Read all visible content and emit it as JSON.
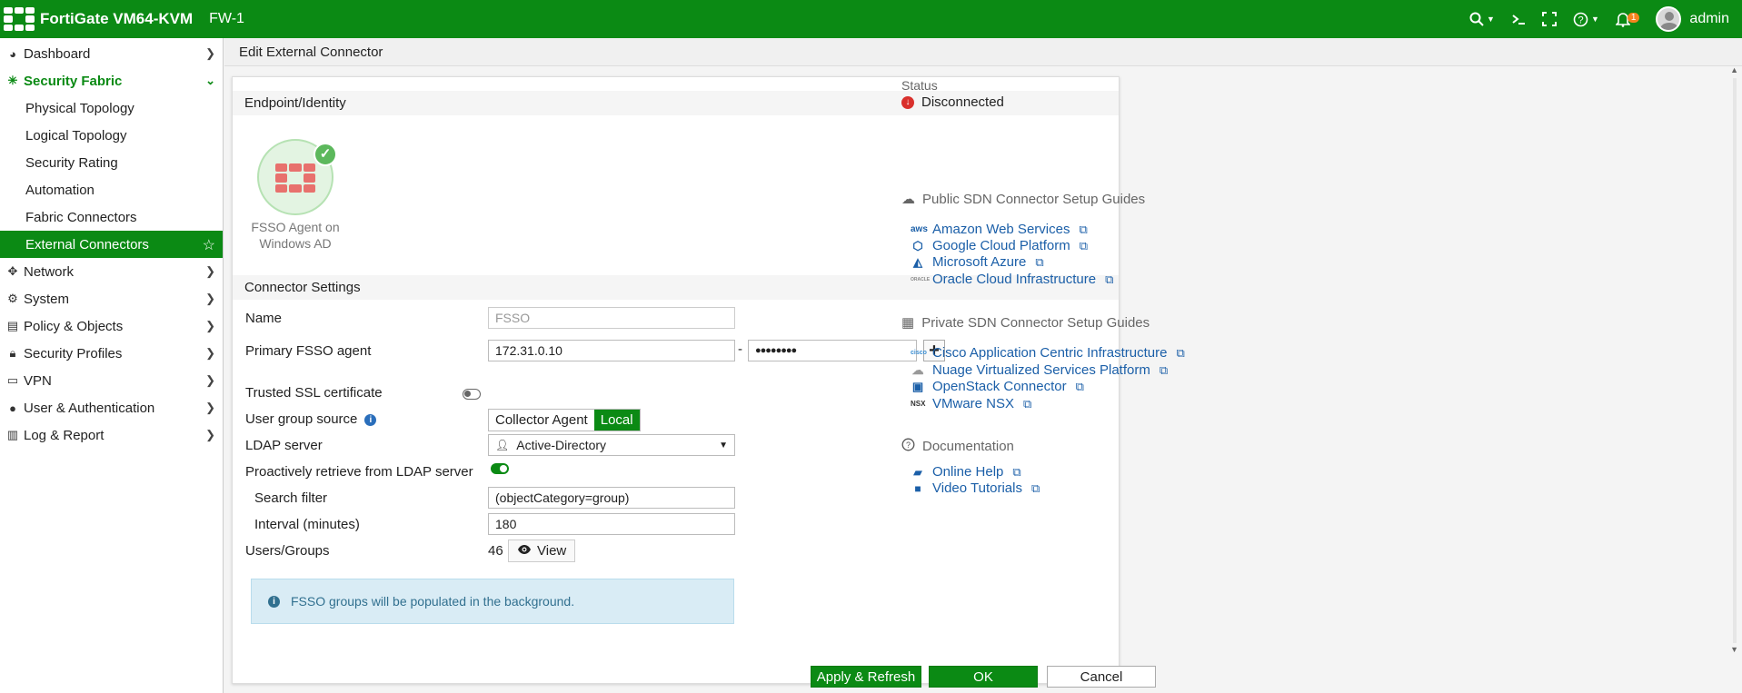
{
  "topbar": {
    "brand": "FortiGate VM64-KVM",
    "hostname": "FW-1",
    "notification_count": "1",
    "user": "admin",
    "icons": [
      "search-icon",
      "cli-icon",
      "fullscreen-icon",
      "help-icon",
      "bell-icon",
      "avatar"
    ]
  },
  "sidebar": {
    "items": [
      {
        "label": "Dashboard",
        "icon": "dashboard-icon"
      },
      {
        "label": "Security Fabric",
        "icon": "fabric-icon"
      },
      {
        "label": "Physical Topology"
      },
      {
        "label": "Logical Topology"
      },
      {
        "label": "Security Rating"
      },
      {
        "label": "Automation"
      },
      {
        "label": "Fabric Connectors"
      },
      {
        "label": "External Connectors"
      },
      {
        "label": "Network",
        "icon": "network-icon"
      },
      {
        "label": "System",
        "icon": "gear-icon"
      },
      {
        "label": "Policy & Objects",
        "icon": "policy-icon"
      },
      {
        "label": "Security Profiles",
        "icon": "lock-icon"
      },
      {
        "label": "VPN",
        "icon": "laptop-icon"
      },
      {
        "label": "User & Authentication",
        "icon": "user-icon"
      },
      {
        "label": "Log & Report",
        "icon": "chart-icon"
      }
    ]
  },
  "page": {
    "title": "Edit External Connector"
  },
  "endpoint": {
    "section_title": "Endpoint/Identity",
    "tile_label": "FSSO Agent on Windows AD"
  },
  "settings": {
    "section_title": "Connector Settings",
    "name_label": "Name",
    "name_value": "FSSO",
    "primary_agent_label": "Primary FSSO agent",
    "primary_agent_ip": "172.31.0.10",
    "separator": "-",
    "password_mask": "●●●●●●●●",
    "trusted_ssl_label": "Trusted SSL certificate",
    "trusted_ssl_on": false,
    "user_group_source_label": "User group source",
    "group_source_options": [
      "Collector Agent",
      "Local"
    ],
    "group_source_selected": "Local",
    "ldap_server_label": "LDAP server",
    "ldap_server_value": "Active-Directory",
    "proactive_label": "Proactively retrieve from LDAP server",
    "proactive_on": true,
    "search_filter_label": "Search filter",
    "search_filter_value": "(objectCategory=group)",
    "interval_label": "Interval (minutes)",
    "interval_value": "180",
    "users_groups_label": "Users/Groups",
    "users_groups_count": "46",
    "view_label": "View",
    "notice": "FSSO groups will be populated in the background."
  },
  "status": {
    "label": "Status",
    "value": "Disconnected",
    "color": "#d9302c"
  },
  "guides": {
    "public_title": "Public SDN Connector Setup Guides",
    "public": [
      {
        "label": "Amazon Web Services",
        "icon": "aws-icon",
        "glyph": "aws"
      },
      {
        "label": "Google Cloud Platform",
        "icon": "gcp-icon",
        "glyph": "⬡"
      },
      {
        "label": "Microsoft Azure",
        "icon": "azure-icon",
        "glyph": "◭"
      },
      {
        "label": "Oracle Cloud Infrastructure",
        "icon": "oracle-icon",
        "glyph": "ORACLE"
      }
    ],
    "private_title": "Private SDN Connector Setup Guides",
    "private": [
      {
        "label": "Cisco Application Centric Infrastructure",
        "icon": "cisco-icon",
        "glyph": "cisco"
      },
      {
        "label": "Nuage Virtualized Services Platform",
        "icon": "nuage-icon",
        "glyph": "☁"
      },
      {
        "label": "OpenStack Connector",
        "icon": "openstack-icon",
        "glyph": "▣"
      },
      {
        "label": "VMware NSX",
        "icon": "nsx-icon",
        "glyph": "NSX"
      }
    ],
    "docs_title": "Documentation",
    "docs": [
      {
        "label": "Online Help",
        "icon": "book-icon",
        "glyph": "📘"
      },
      {
        "label": "Video Tutorials",
        "icon": "video-icon",
        "glyph": "■"
      }
    ]
  },
  "footer": {
    "apply_label": "Apply & Refresh",
    "ok_label": "OK",
    "cancel_label": "Cancel"
  },
  "colors": {
    "brand_green": "#0b8a14",
    "link_blue": "#1b5fa8"
  }
}
